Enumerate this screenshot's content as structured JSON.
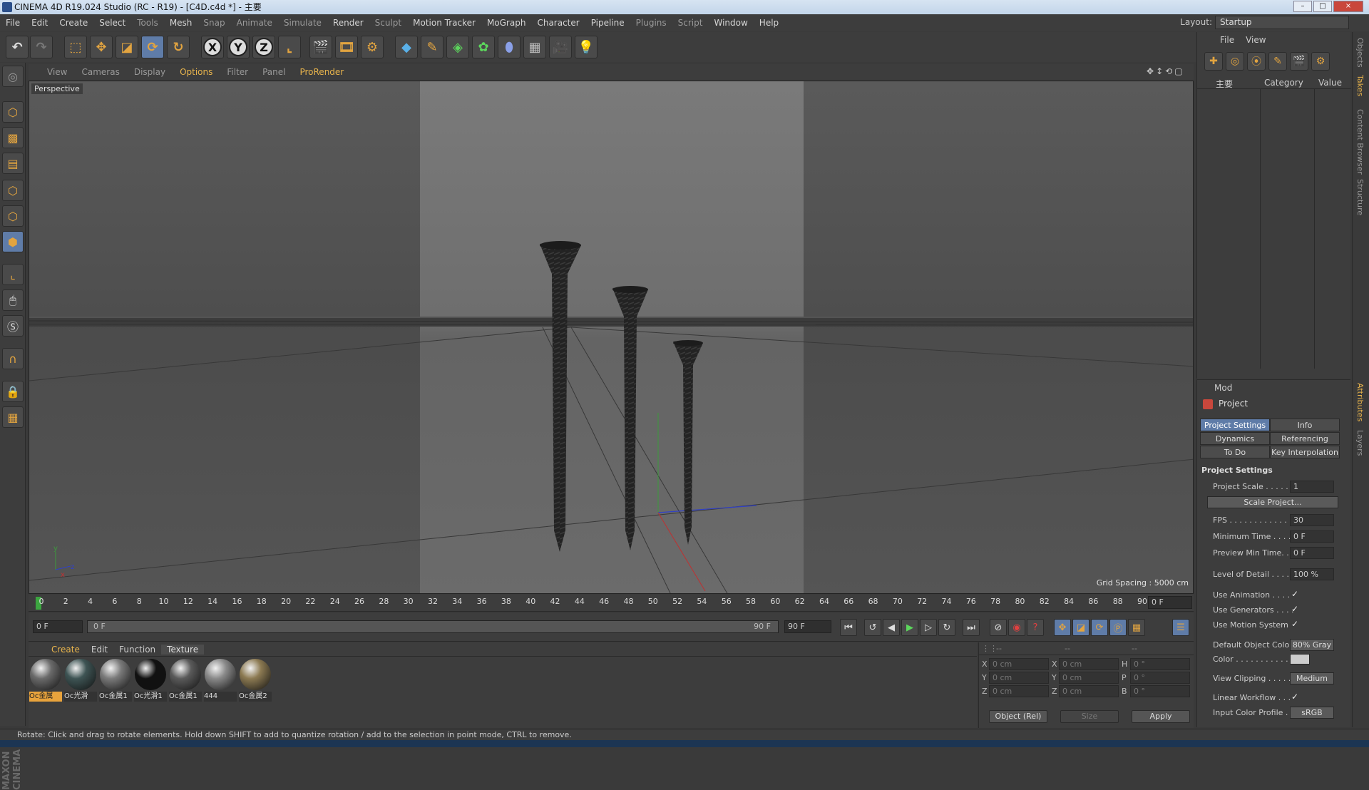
{
  "window": {
    "title": "CINEMA 4D R19.024 Studio (RC - R19) - [C4D.c4d *] - 主要",
    "buttons": [
      "–",
      "□",
      "×"
    ]
  },
  "menubar": {
    "items": [
      "File",
      "Edit",
      "Create",
      "Select",
      "Tools",
      "Mesh",
      "Snap",
      "Animate",
      "Simulate",
      "Render",
      "Sculpt",
      "Motion Tracker",
      "MoGraph",
      "Character",
      "Pipeline",
      "Plugins",
      "Script",
      "Window",
      "Help"
    ],
    "layout_label": "Layout:",
    "layout_value": "Startup"
  },
  "toolbar": {
    "axis_x": "X",
    "axis_y": "Y",
    "axis_z": "Z"
  },
  "viewport": {
    "menu": [
      "View",
      "Cameras",
      "Display",
      "Options",
      "Filter",
      "Panel",
      "ProRender"
    ],
    "highlight_index": 3,
    "camera_label": "Perspective",
    "grid_spacing": "Grid Spacing : 5000 cm",
    "axis_y": "y",
    "axis_x": "x",
    "axis_z": "z"
  },
  "timeline": {
    "ticks": [
      "0",
      "2",
      "4",
      "6",
      "8",
      "10",
      "12",
      "14",
      "16",
      "18",
      "20",
      "22",
      "24",
      "26",
      "28",
      "30",
      "32",
      "34",
      "36",
      "38",
      "40",
      "42",
      "44",
      "46",
      "48",
      "50",
      "52",
      "54",
      "56",
      "58",
      "60",
      "62",
      "64",
      "66",
      "68",
      "70",
      "72",
      "74",
      "76",
      "78",
      "80",
      "82",
      "84",
      "86",
      "88",
      "90"
    ],
    "current_frame": "0 F",
    "start_frame": "0 F",
    "slider_start": "0 F",
    "slider_end": "90 F",
    "end_frame": "90 F"
  },
  "materials": {
    "menu": [
      "Create",
      "Edit",
      "Function",
      "Texture"
    ],
    "items": [
      {
        "label": "Oc金属",
        "color": "#6a6a6a",
        "selected": true
      },
      {
        "label": "Oc光滑",
        "color": "#3e5454",
        "selected": false
      },
      {
        "label": "Oc金属1",
        "color": "#7a7a7a",
        "selected": false
      },
      {
        "label": "Oc光滑1",
        "color": "#111111",
        "selected": false
      },
      {
        "label": "Oc金属1",
        "color": "#5a5a5a",
        "selected": false
      },
      {
        "label": "444",
        "color": "#8a8a8a",
        "selected": false
      },
      {
        "label": "Oc金属2",
        "color": "#8c7a52",
        "selected": false
      }
    ]
  },
  "coords": {
    "head": [
      "--",
      "--",
      "--"
    ],
    "rows": [
      {
        "a": "X",
        "av": "0 cm",
        "b": "X",
        "bv": "0 cm",
        "c": "H",
        "cv": "0 °"
      },
      {
        "a": "Y",
        "av": "0 cm",
        "b": "Y",
        "bv": "0 cm",
        "c": "P",
        "cv": "0 °"
      },
      {
        "a": "Z",
        "av": "0 cm",
        "b": "Z",
        "bv": "0 cm",
        "c": "B",
        "cv": "0 °"
      }
    ],
    "mode": "Object (Rel)",
    "size": "Size",
    "apply": "Apply"
  },
  "object_manager": {
    "menu": [
      "File",
      "View"
    ],
    "col_name": "主要",
    "col_category": "Category",
    "col_value": "Value"
  },
  "attributes": {
    "menu": "Mod",
    "title": "Project",
    "tabs": [
      "Project Settings",
      "Info",
      "Dynamics",
      "Referencing",
      "To Do",
      "Key Interpolation"
    ],
    "section": "Project Settings",
    "project_scale_label": "Project Scale . . . . . .",
    "project_scale": "1",
    "scale_project": "Scale Project...",
    "fps_label": "FPS . . . . . . . . . . . . . .",
    "fps": "30",
    "min_time_label": "Minimum Time . . . .",
    "min_time": "0 F",
    "preview_min_label": "Preview Min Time. . .",
    "preview_min": "0 F",
    "lod_label": "Level of Detail . . . . .",
    "lod": "100 %",
    "use_animation": "Use Animation . . . .",
    "use_generators": "Use Generators . . . .",
    "use_motion": "Use Motion System",
    "default_color_label": "Default Object Color",
    "default_color": "80% Gray",
    "color_label": "Color . . . . . . . . . . .",
    "view_clipping_label": "View Clipping . . . . .",
    "view_clipping": "Medium",
    "linear_workflow": "Linear Workflow . . .",
    "input_profile_label": "Input Color Profile . .",
    "input_profile": "sRGB",
    "checkmark": "✓"
  },
  "side_tabs": [
    "Objects",
    "Takes",
    "Content Browser",
    "Structure",
    "Attributes",
    "Layers"
  ],
  "status": "Rotate: Click and drag to rotate elements. Hold down SHIFT to add to quantize rotation / add to the selection in point mode, CTRL to remove.",
  "branding": "MAXON CINEMA 4D"
}
